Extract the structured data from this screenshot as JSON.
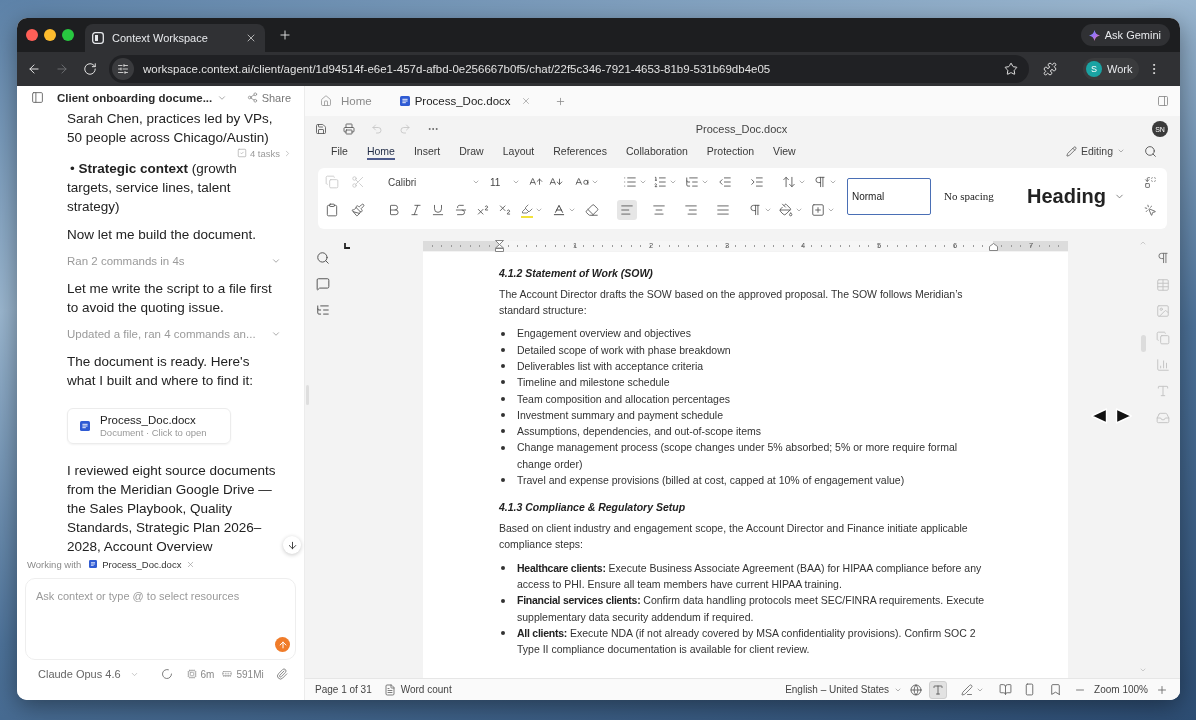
{
  "browser": {
    "tabs": [
      {
        "title": "Context Workspace",
        "selected": true
      }
    ],
    "ask_button": "Ask Gemini",
    "nav": [
      {
        "kind": "back",
        "disabled": false
      },
      {
        "kind": "forward",
        "disabled": true
      },
      {
        "kind": "reload",
        "disabled": false
      }
    ],
    "url": "workspace.context.ai/client/agent/1d94514f-e6e1-457d-afbd-0e256667b0f5/chat/22f5c346-7921-4653-81b9-531b69db4e05",
    "profile": {
      "initial": "S",
      "label": "Work"
    }
  },
  "chat": {
    "title": "Client onboarding docume...",
    "share": "Share",
    "tasks": "4 tasks",
    "messages": [
      {
        "kind": "text",
        "text": "Sarah Chen, practices led by VPs, 50 people across Chicago/Austin)"
      },
      {
        "kind": "bullet",
        "text": "• **Strategic context** (growth targets, service lines, talent strategy)"
      },
      {
        "kind": "text",
        "text": "Now let me build the document."
      },
      {
        "kind": "activity",
        "text": "Ran 2 commands in 4s",
        "expanded": false
      },
      {
        "kind": "text",
        "text": "Let me write the script to a file first to avoid the quoting issue."
      },
      {
        "kind": "activity",
        "text": "Updated a file, ran 4 commands an...",
        "expanded": false
      },
      {
        "kind": "text",
        "text": "The document is ready. Here's what I built and where to find it:"
      },
      {
        "kind": "file",
        "name": "Process_Doc.docx",
        "meta": "Document · Click to open"
      },
      {
        "kind": "text",
        "text": "I reviewed eight source documents from the Meridian Google Drive — the Sales Playbook, Quality Standards, Strategic Plan 2026–2028, Account Overview"
      }
    ],
    "working_with": {
      "label": "Working with",
      "file": "Process_Doc.docx"
    },
    "composer": {
      "placeholder": "Ask context or type @ to select resources"
    },
    "footer": {
      "model": "Claude Opus 4.6",
      "duration": "6m",
      "memory": "591Mi"
    }
  },
  "editor": {
    "tabs": [
      {
        "kind": "home",
        "label": "Home",
        "selected": false
      },
      {
        "kind": "document",
        "label": "Process_Doc.docx",
        "selected": true
      }
    ],
    "quick_actions": [
      {
        "kind": "save",
        "disabled": false
      },
      {
        "kind": "print",
        "disabled": false
      },
      {
        "kind": "undo",
        "disabled": true
      },
      {
        "kind": "redo",
        "disabled": true
      },
      {
        "kind": "more",
        "disabled": false
      }
    ],
    "title": "Process_Doc.docx",
    "avatar": "SN",
    "menu": [
      {
        "label": "File",
        "selected": false
      },
      {
        "label": "Home",
        "selected": true
      },
      {
        "label": "Insert",
        "selected": false
      },
      {
        "label": "Draw",
        "selected": false
      },
      {
        "label": "Layout",
        "selected": false
      },
      {
        "label": "References",
        "selected": false
      },
      {
        "label": "Collaboration",
        "selected": false
      },
      {
        "label": "Protection",
        "selected": false
      },
      {
        "label": "View",
        "selected": false
      }
    ],
    "mode": "Editing",
    "ribbon": {
      "clipboard": [
        {
          "kind": "copy",
          "disabled": true
        },
        {
          "kind": "cut",
          "disabled": true
        }
      ],
      "font": "Calibri",
      "size": "11",
      "alignment": [
        {
          "kind": "left",
          "selected": true
        },
        {
          "kind": "center",
          "selected": false
        },
        {
          "kind": "right",
          "selected": false
        },
        {
          "kind": "justify",
          "selected": false
        }
      ],
      "styles": [
        {
          "kind": "normal",
          "label": "Normal",
          "selected": true
        },
        {
          "kind": "no_spacing",
          "label": "No spacing",
          "selected": false
        },
        {
          "kind": "heading",
          "label": "Heading",
          "selected": false
        }
      ]
    },
    "ruler": [
      "1",
      "2",
      "3",
      "4",
      "5",
      "6",
      "7"
    ],
    "document": [
      {
        "kind": "heading",
        "text": "4.1.2 Statement of Work (SOW)"
      },
      {
        "kind": "paragraph",
        "text": "The Account Director drafts the SOW based on the approved proposal. The SOW follows Meridian’s standard structure:"
      },
      {
        "kind": "bullets",
        "items": [
          "Engagement overview and objectives",
          "Detailed scope of work with phase breakdown",
          "Deliverables list with acceptance criteria",
          "Timeline and milestone schedule",
          "Team composition and allocation percentages",
          "Investment summary and payment schedule",
          "Assumptions, dependencies, and out-of-scope items",
          "Change management process (scope changes under 5% absorbed; 5% or more require formal change order)",
          "Travel and expense provisions (billed at cost, capped at 10% of engagement value)"
        ]
      },
      {
        "kind": "heading",
        "text": "4.1.3 Compliance & Regulatory Setup"
      },
      {
        "kind": "paragraph",
        "text": "Based on client industry and engagement scope, the Account Director and Finance initiate applicable compliance steps:"
      },
      {
        "kind": "bullets",
        "items": [
          "**Healthcare clients:** Execute Business Associate Agreement (BAA) for HIPAA compliance before any access to PHI. Ensure all team members have current HIPAA training.",
          "**Financial services clients:** Confirm data handling protocols meet SEC/FINRA requirements. Execute supplementary data security addendum if required.",
          "**All clients:** Execute NDA (if not already covered by MSA confidentiality provisions). Confirm SOC 2 Type II compliance documentation is available for client review."
        ]
      }
    ],
    "status_bar": {
      "page": "Page 1 of 31",
      "word_count": "Word count",
      "language": "English – United States",
      "toggles": [
        {
          "kind": "globe",
          "selected": false
        },
        {
          "kind": "text",
          "selected": true
        }
      ],
      "zoom": "Zoom 100%"
    }
  }
}
